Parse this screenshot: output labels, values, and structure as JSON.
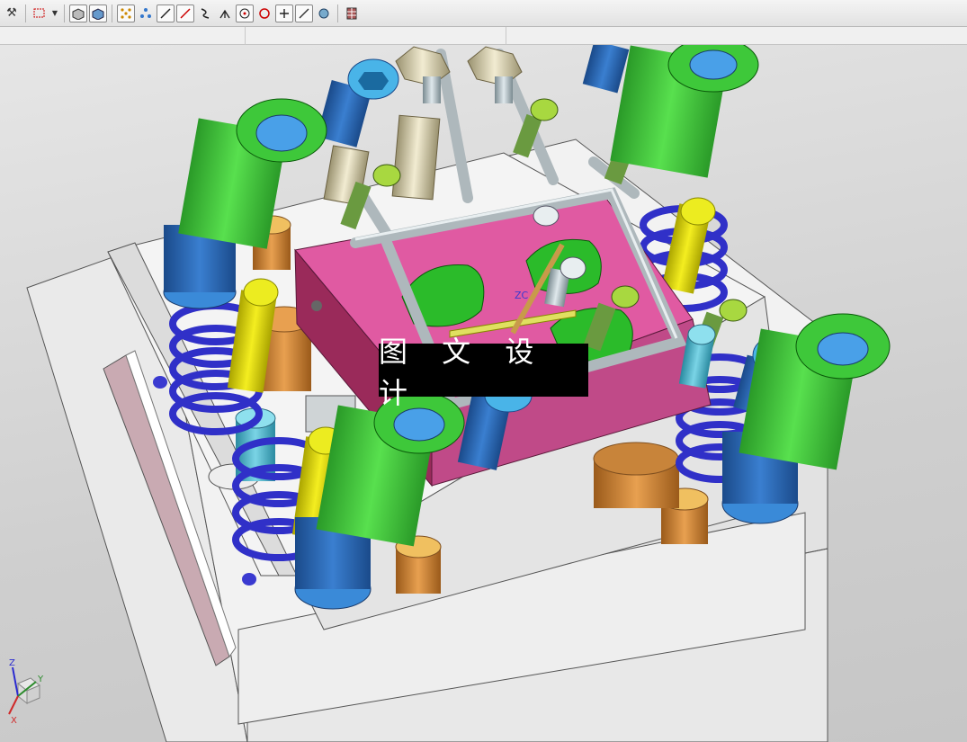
{
  "toolbar": {
    "icons": [
      "snap-icon",
      "select-rectangle-icon",
      "dropdown-arrow-icon",
      "shaded-box-icon",
      "solid-box-icon",
      "point-grid-icon",
      "snap-points-icon",
      "line-icon",
      "line-slash-icon",
      "curve-icon",
      "perpendicular-icon",
      "circle-center-icon",
      "circle-quadrant-icon",
      "plus-icon",
      "slash-icon",
      "shade-icon",
      "grid-icon"
    ]
  },
  "viewport": {
    "watermark_text": "图 文 设 计",
    "wcs_label": "ZC",
    "triad": {
      "z": "Z",
      "y": "Y",
      "x": "X"
    }
  },
  "colors": {
    "plate_pink": "#dd5ba0",
    "guide_green": "#3ec83a",
    "spring_blue": "#3030c8",
    "pin_yellow": "#e8e000",
    "bolt_blue": "#2f7fd0",
    "pin_orange": "#d88a38",
    "background": "#d9d9d9"
  }
}
